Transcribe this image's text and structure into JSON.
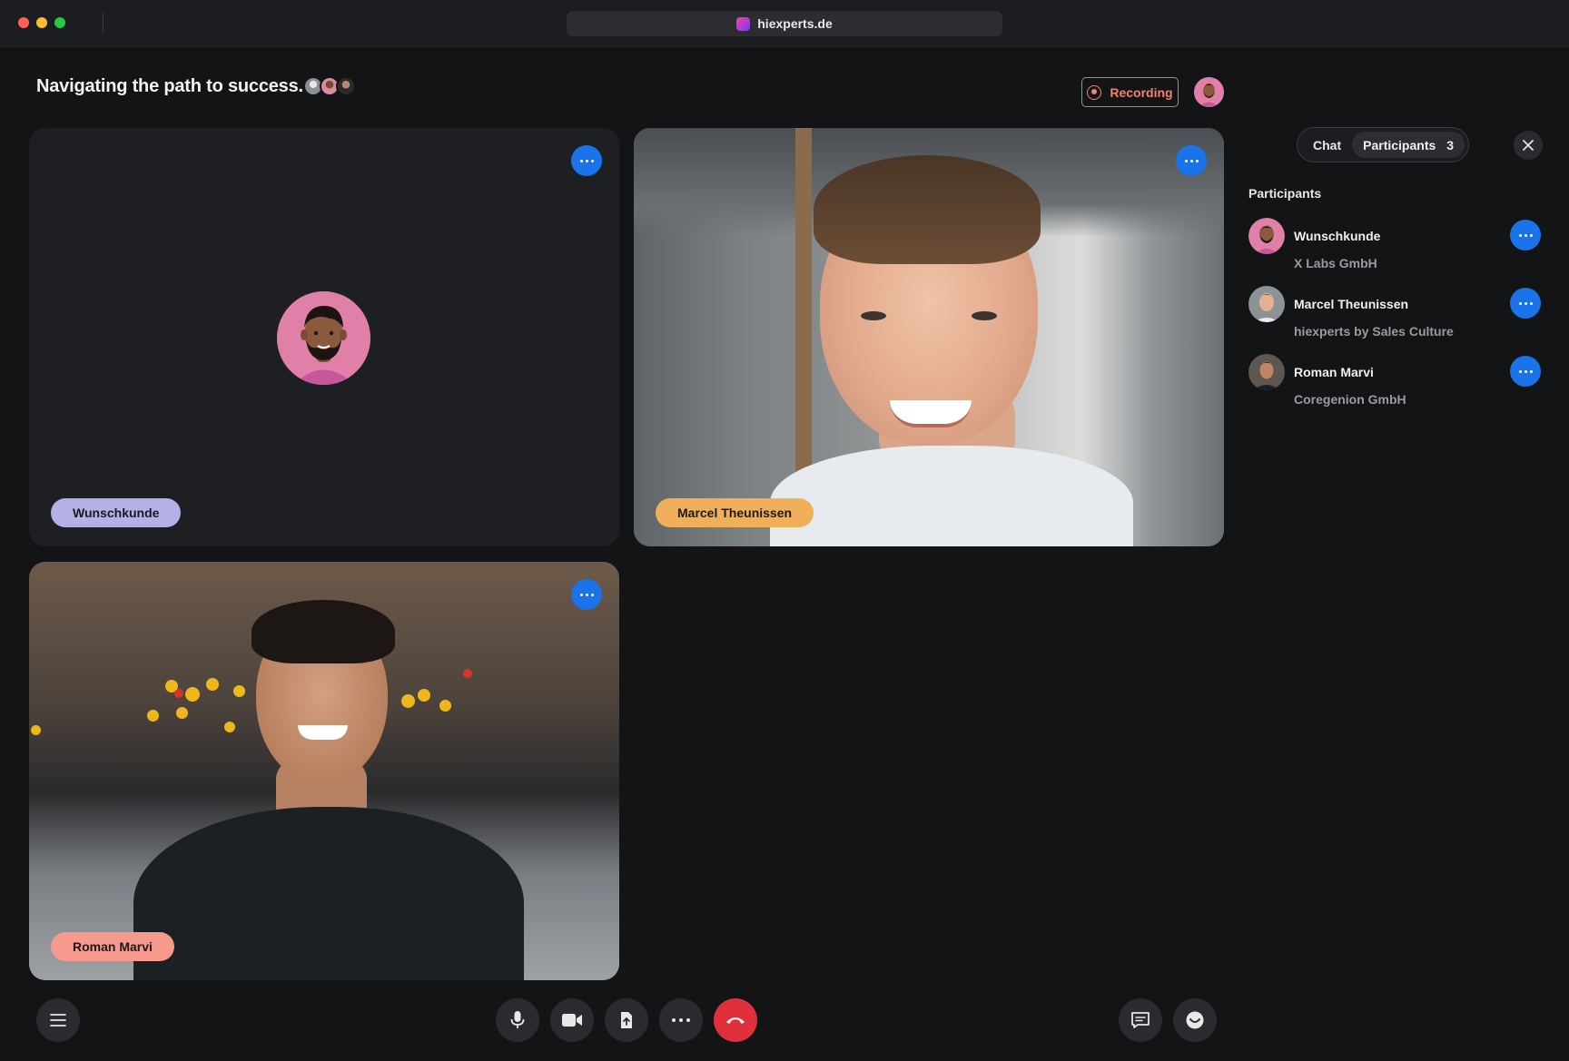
{
  "window": {
    "url": "hiexperts.de"
  },
  "meeting": {
    "title": "Navigating the path to success.",
    "recording_label": "Recording"
  },
  "tiles": [
    {
      "name": "Wunschkunde",
      "color": "#b4b1e6",
      "video": false
    },
    {
      "name": "Marcel Theunissen",
      "color": "#f0b05a",
      "video": true
    },
    {
      "name": "Roman Marvi",
      "color": "#f59a8c",
      "video": true
    }
  ],
  "sidebar": {
    "tabs": {
      "chat": "Chat",
      "participants": "Participants",
      "participants_count": "3"
    },
    "heading": "Participants",
    "participants": [
      {
        "name": "Wunschkunde",
        "org": "X Labs GmbH"
      },
      {
        "name": "Marcel Theunissen",
        "org": "hiexperts by Sales Culture"
      },
      {
        "name": "Roman Marvi",
        "org": "Coregenion GmbH"
      }
    ]
  },
  "controls": [
    {
      "id": "menu",
      "icon": "hamburger-menu-icon"
    },
    {
      "id": "mic",
      "icon": "microphone-icon"
    },
    {
      "id": "camera",
      "icon": "video-camera-icon"
    },
    {
      "id": "share",
      "icon": "share-screen-icon"
    },
    {
      "id": "more",
      "icon": "more-horizontal-icon"
    },
    {
      "id": "leave",
      "icon": "end-call-icon"
    },
    {
      "id": "chat",
      "icon": "chat-bubble-icon"
    },
    {
      "id": "reactions",
      "icon": "emoji-icon"
    }
  ],
  "colors": {
    "accent_blue": "#1a73e8",
    "recording": "#f0826e",
    "end_call": "#e0303c"
  }
}
